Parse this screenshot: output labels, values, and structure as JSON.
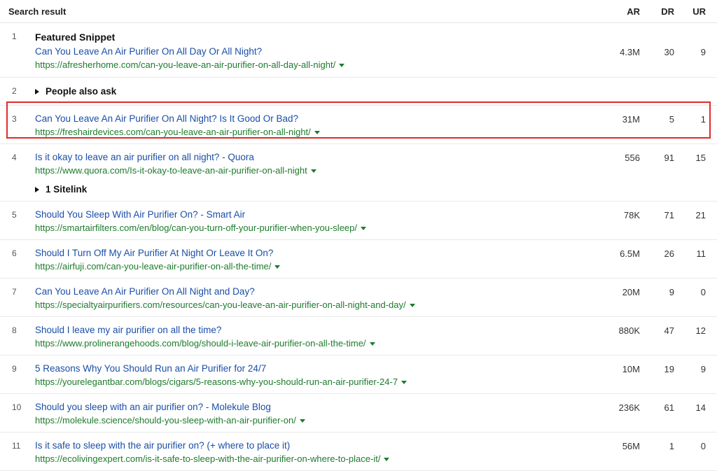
{
  "header": {
    "title": "Search result",
    "ar": "AR",
    "dr": "DR",
    "ur": "UR"
  },
  "rows": [
    {
      "pos": "1",
      "label": "Featured Snippet",
      "title": "Can You Leave An Air Purifier On All Day Or All Night?",
      "url": "https://afresherhome.com/can-you-leave-an-air-purifier-on-all-day-all-night/",
      "ar": "4.3M",
      "dr": "30",
      "ur": "9"
    },
    {
      "pos": "2",
      "label": "People also ask"
    },
    {
      "pos": "3",
      "title": "Can You Leave An Air Purifier On All Night? Is It Good Or Bad?",
      "url": "https://freshairdevices.com/can-you-leave-an-air-purifier-on-all-night/",
      "ar": "31M",
      "dr": "5",
      "ur": "1"
    },
    {
      "pos": "4",
      "title": "Is it okay to leave an air purifier on all night? - Quora",
      "url": "https://www.quora.com/Is-it-okay-to-leave-an-air-purifier-on-all-night",
      "sitelink": "1 Sitelink",
      "ar": "556",
      "dr": "91",
      "ur": "15"
    },
    {
      "pos": "5",
      "title": "Should You Sleep With Air Purifier On? - Smart Air",
      "url": "https://smartairfilters.com/en/blog/can-you-turn-off-your-purifier-when-you-sleep/",
      "ar": "78K",
      "dr": "71",
      "ur": "21"
    },
    {
      "pos": "6",
      "title": "Should I Turn Off My Air Purifier At Night Or Leave It On?",
      "url": "https://airfuji.com/can-you-leave-air-purifier-on-all-the-time/",
      "ar": "6.5M",
      "dr": "26",
      "ur": "11"
    },
    {
      "pos": "7",
      "title": "Can You Leave An Air Purifier On All Night and Day?",
      "url": "https://specialtyairpurifiers.com/resources/can-you-leave-an-air-purifier-on-all-night-and-day/",
      "ar": "20M",
      "dr": "9",
      "ur": "0"
    },
    {
      "pos": "8",
      "title": "Should I leave my air purifier on all the time?",
      "url": "https://www.prolinerangehoods.com/blog/should-i-leave-air-purifier-on-all-the-time/",
      "ar": "880K",
      "dr": "47",
      "ur": "12"
    },
    {
      "pos": "9",
      "title": "5 Reasons Why You Should Run an Air Purifier for 24/7",
      "url": "https://yourelegantbar.com/blogs/cigars/5-reasons-why-you-should-run-an-air-purifier-24-7",
      "ar": "10M",
      "dr": "19",
      "ur": "9"
    },
    {
      "pos": "10",
      "title": "Should you sleep with an air purifier on? - Molekule Blog",
      "url": "https://molekule.science/should-you-sleep-with-an-air-purifier-on/",
      "ar": "236K",
      "dr": "61",
      "ur": "14"
    },
    {
      "pos": "11",
      "title": "Is it safe to sleep with the air purifier on? (+ where to place it)",
      "url": "https://ecolivingexpert.com/is-it-safe-to-sleep-with-the-air-purifier-on-where-to-place-it/",
      "ar": "56M",
      "dr": "1",
      "ur": "0"
    }
  ],
  "highlight_color": "#e02b27",
  "link_color": "#1a4ea8",
  "url_color": "#1d7b2c"
}
